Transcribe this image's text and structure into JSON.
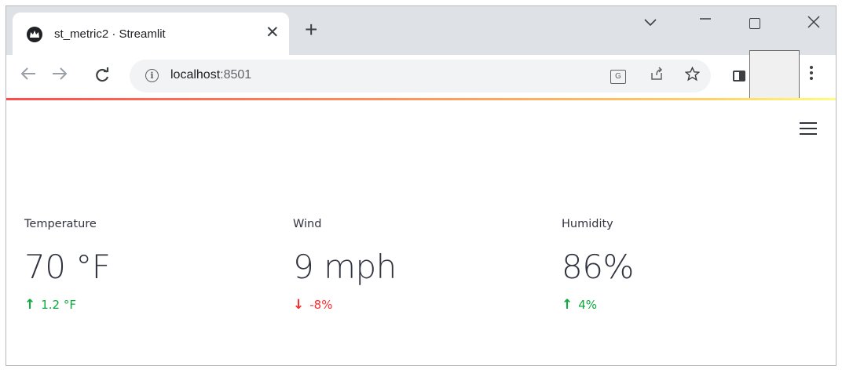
{
  "browser": {
    "tab_title": "st_metric2 · Streamlit",
    "tab_close": "✕",
    "new_tab": "+",
    "url_host": "localhost",
    "url_port": ":8501"
  },
  "app": {
    "metrics": [
      {
        "label": "Temperature",
        "value": "70 °F",
        "delta": "1.2 °F",
        "direction": "up",
        "color": "#09ab3b"
      },
      {
        "label": "Wind",
        "value": "9 mph",
        "delta": "-8%",
        "direction": "down",
        "color": "#ff2b2b"
      },
      {
        "label": "Humidity",
        "value": "86%",
        "delta": "4%",
        "direction": "up",
        "color": "#09ab3b"
      }
    ]
  },
  "icons": {
    "up_arrow": "↑",
    "down_arrow": "↓"
  }
}
